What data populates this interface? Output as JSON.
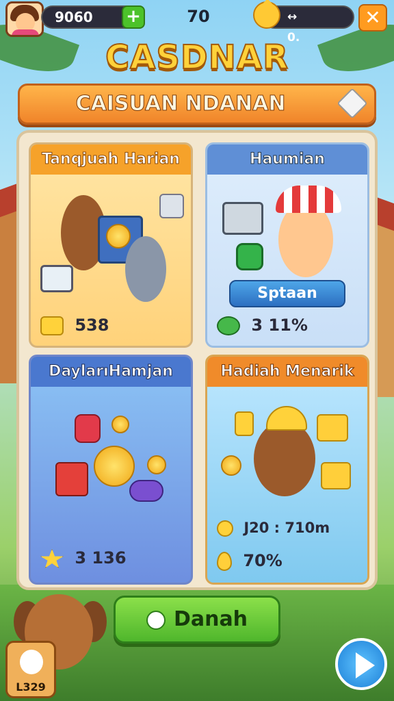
{
  "hud": {
    "coins": "9060",
    "add_label": "+",
    "center_value": "70",
    "right_left": "↔",
    "right_value": "0.",
    "close_label": "✕"
  },
  "title": "CASDNAR",
  "banner": "CAISUAN NDANAN",
  "cards": [
    {
      "title": "Tanqjuah Harian",
      "footer": "538"
    },
    {
      "title": "Haumian",
      "button": "Sptaan",
      "footer": "3 11%"
    },
    {
      "title": "DaylarıHamjan",
      "footer": "3 136"
    },
    {
      "title": "Hadiah Menarik",
      "footer_a": "J20 : 710m",
      "footer_b": "70%"
    }
  ],
  "main_button": "Danah",
  "bottom_left_label": "L329",
  "colors": {
    "title": "#ffd23a",
    "banner": "#f0842a",
    "primary_button": "#4fb62c",
    "play_button": "#1c7fd6"
  }
}
